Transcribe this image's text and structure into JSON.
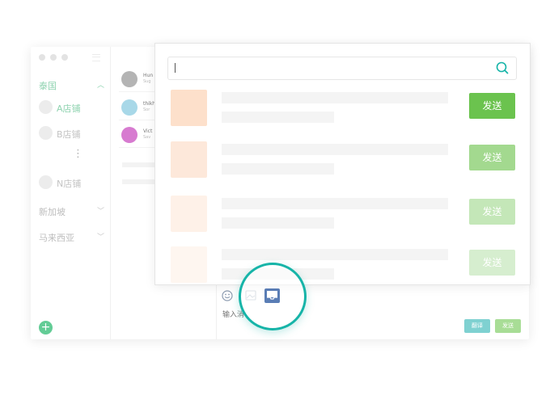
{
  "sidebar": {
    "groups": [
      {
        "label": "泰国",
        "active": true
      },
      {
        "label": "新加坡",
        "active": false
      },
      {
        "label": "马来西亚",
        "active": false
      }
    ],
    "stores": [
      {
        "label": "A店铺",
        "active": true
      },
      {
        "label": "B店铺",
        "active": false
      },
      {
        "label": "N店铺",
        "active": false
      }
    ],
    "more_glyph": "⋮",
    "add_glyph": "+"
  },
  "chat_list": {
    "items": [
      {
        "name": "Hun",
        "preview": "Sug",
        "avatar_color": "#b4b4b4"
      },
      {
        "name": "thikh",
        "preview": "Sor",
        "avatar_color": "#a8d8e8"
      },
      {
        "name": "Vict",
        "preview": "Sav",
        "avatar_color": "#d77bd0"
      }
    ]
  },
  "composer": {
    "placeholder": "输入消",
    "translate_label": "翻译",
    "send_label": "发送",
    "translate_color": "#7fd1d1",
    "send_color": "#a8dd96"
  },
  "panel": {
    "search_value": "",
    "rows": [
      {
        "send_label": "发送",
        "thumb_color": "#fde0cb",
        "button_color": "#6bc34e"
      },
      {
        "send_label": "发送",
        "thumb_color": "#fde8da",
        "button_color": "#a3d98f"
      },
      {
        "send_label": "发送",
        "thumb_color": "#fef1e8",
        "button_color": "#c4e7b8"
      },
      {
        "send_label": "发送",
        "thumb_color": "#fef6f0",
        "button_color": "#d6eecf"
      }
    ]
  },
  "colors": {
    "accent_teal": "#16b4a8",
    "accent_green": "#63cc96",
    "inbox_icon": "#5a7db5"
  }
}
